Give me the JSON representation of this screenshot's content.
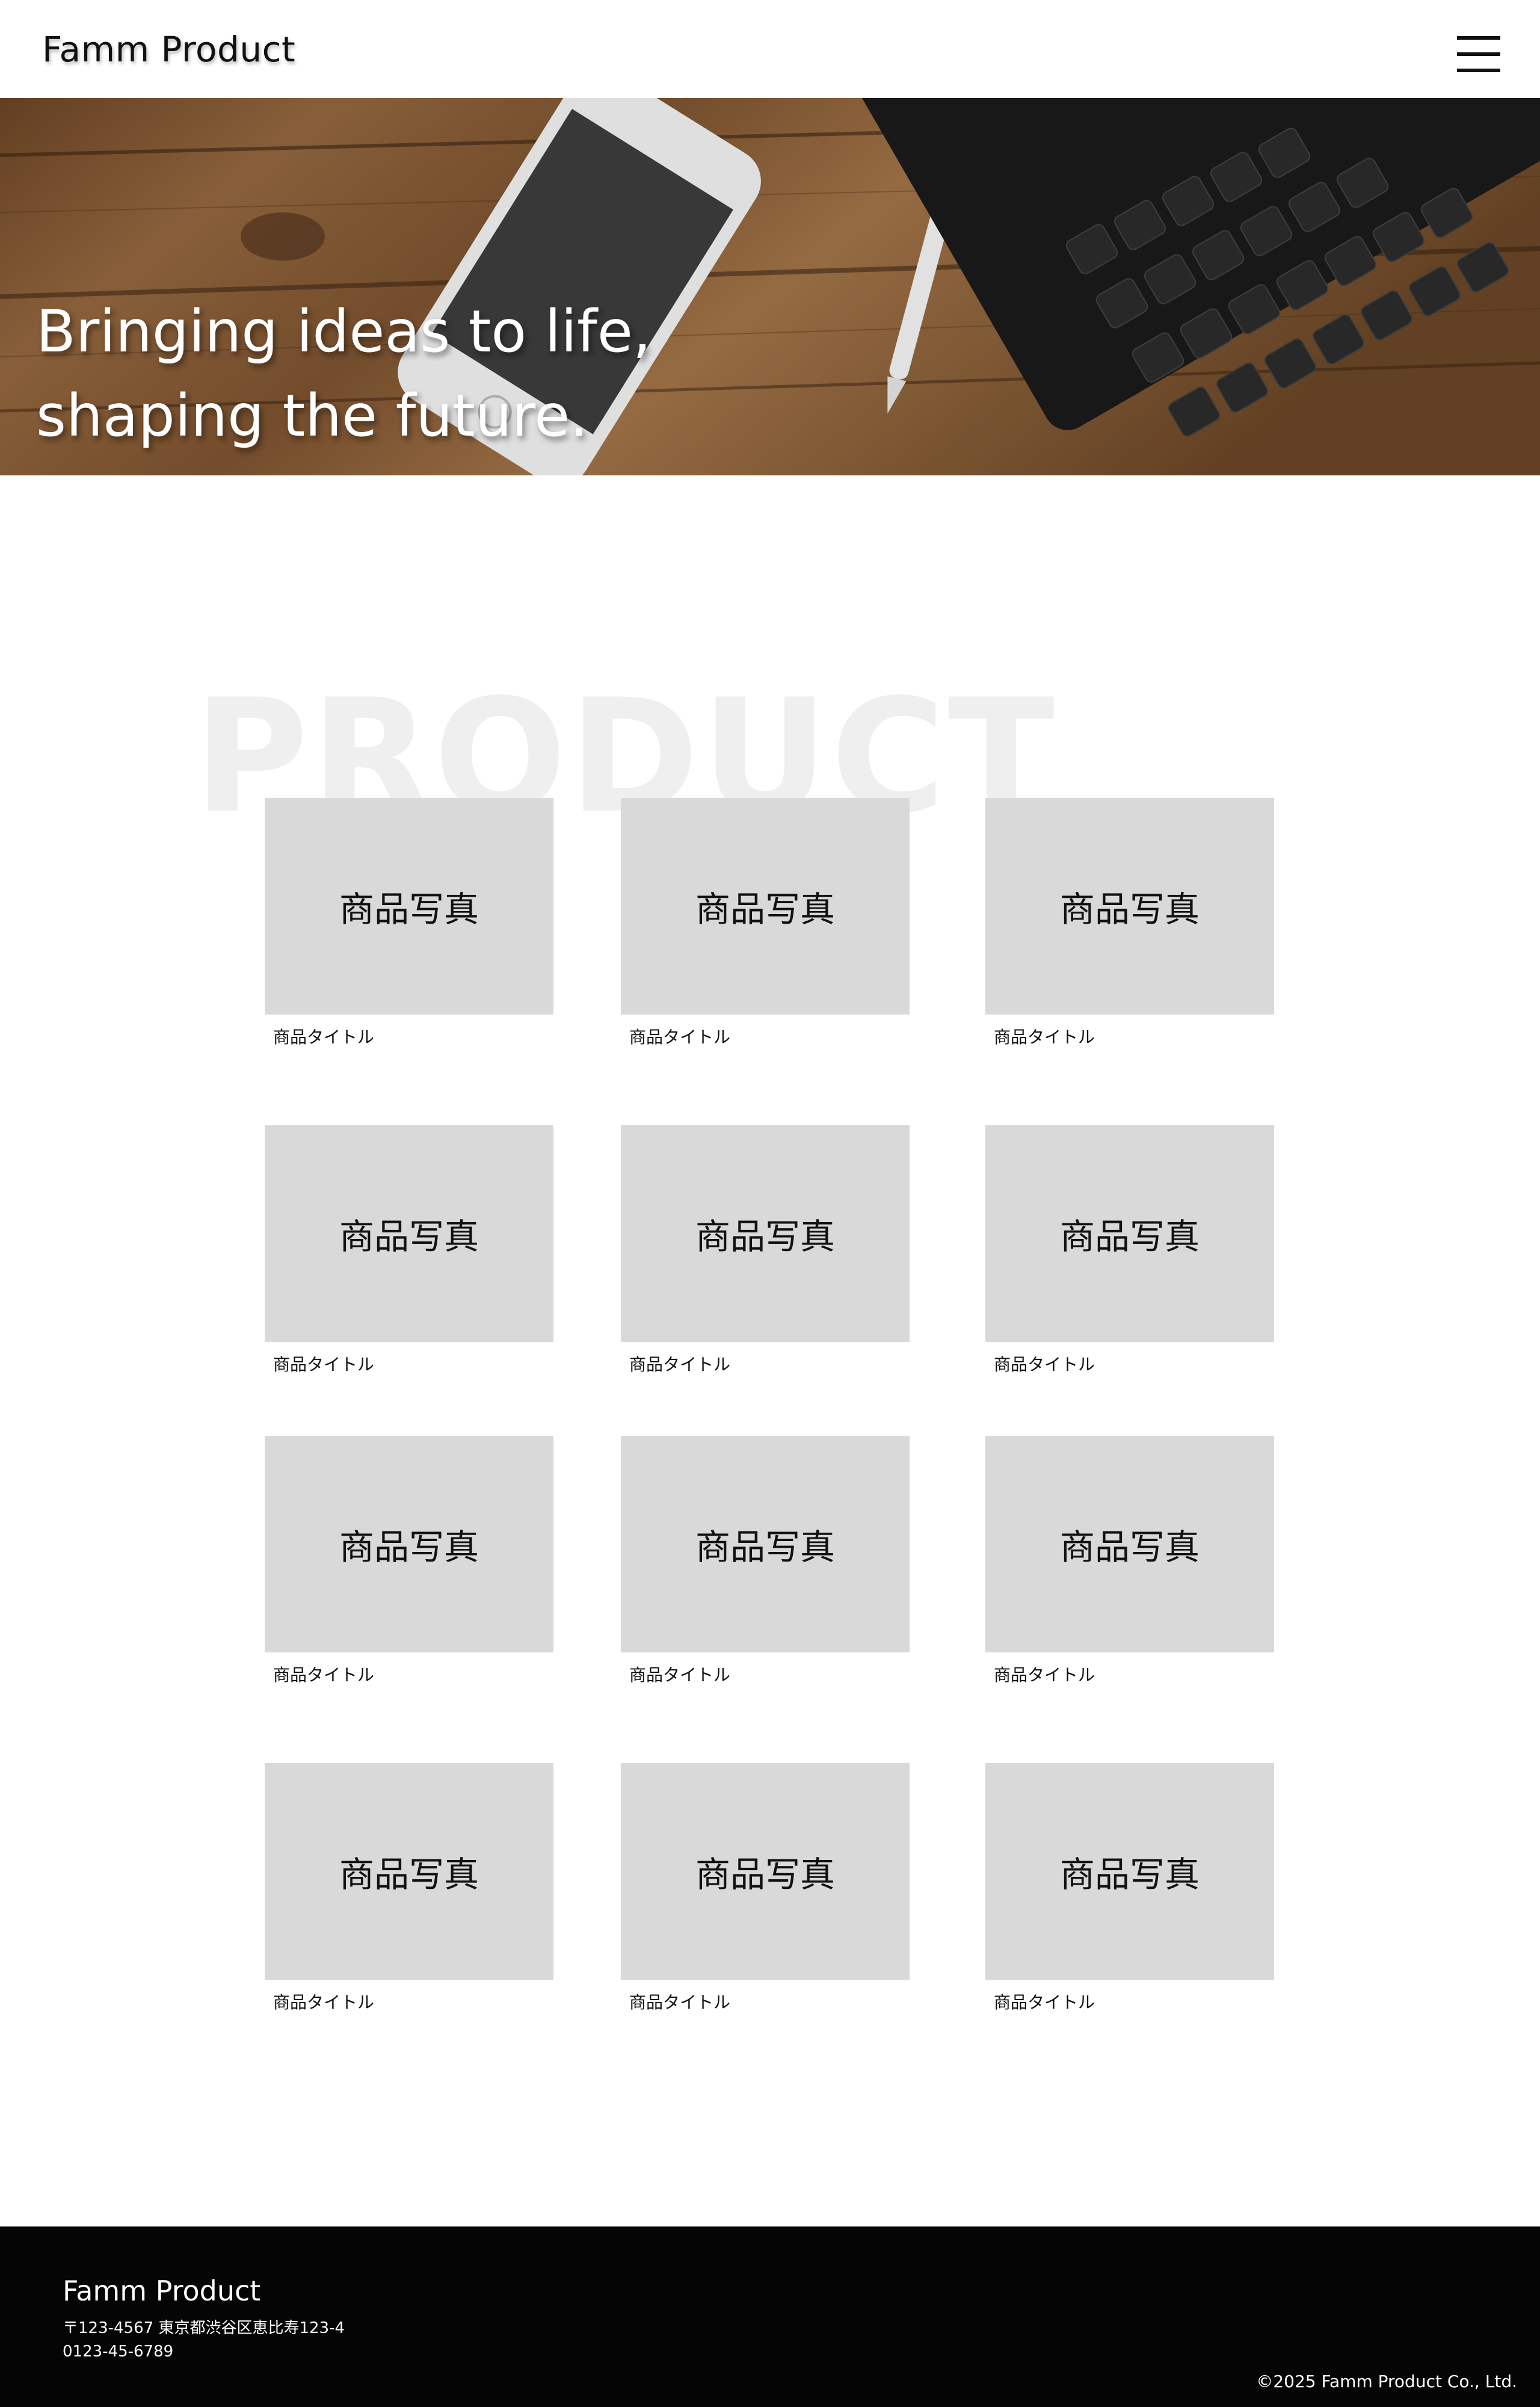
{
  "header": {
    "logo": "Famm Product",
    "menu_icon": "hamburger-menu-icon"
  },
  "hero": {
    "line1": "Bringing ideas to life,",
    "line2": "shaping the future."
  },
  "product_section": {
    "watermark": "PRODUCT",
    "items": [
      {
        "photo": "商品写真",
        "title": "商品タイトル"
      },
      {
        "photo": "商品写真",
        "title": "商品タイトル"
      },
      {
        "photo": "商品写真",
        "title": "商品タイトル"
      },
      {
        "photo": "商品写真",
        "title": "商品タイトル"
      },
      {
        "photo": "商品写真",
        "title": "商品タイトル"
      },
      {
        "photo": "商品写真",
        "title": "商品タイトル"
      },
      {
        "photo": "商品写真",
        "title": "商品タイトル"
      },
      {
        "photo": "商品写真",
        "title": "商品タイトル"
      },
      {
        "photo": "商品写真",
        "title": "商品タイトル"
      },
      {
        "photo": "商品写真",
        "title": "商品タイトル"
      },
      {
        "photo": "商品写真",
        "title": "商品タイトル"
      },
      {
        "photo": "商品写真",
        "title": "商品タイトル"
      }
    ]
  },
  "footer": {
    "company": "Famm Product",
    "address": "〒123-4567 東京都渋谷区恵比寿123-4",
    "tel": "0123-45-6789",
    "copyright": "©2025 Famm Product Co., Ltd."
  },
  "colors": {
    "placeholder_bg": "#d9d9d9",
    "footer_bg": "#050505",
    "watermark": "#efefef"
  }
}
